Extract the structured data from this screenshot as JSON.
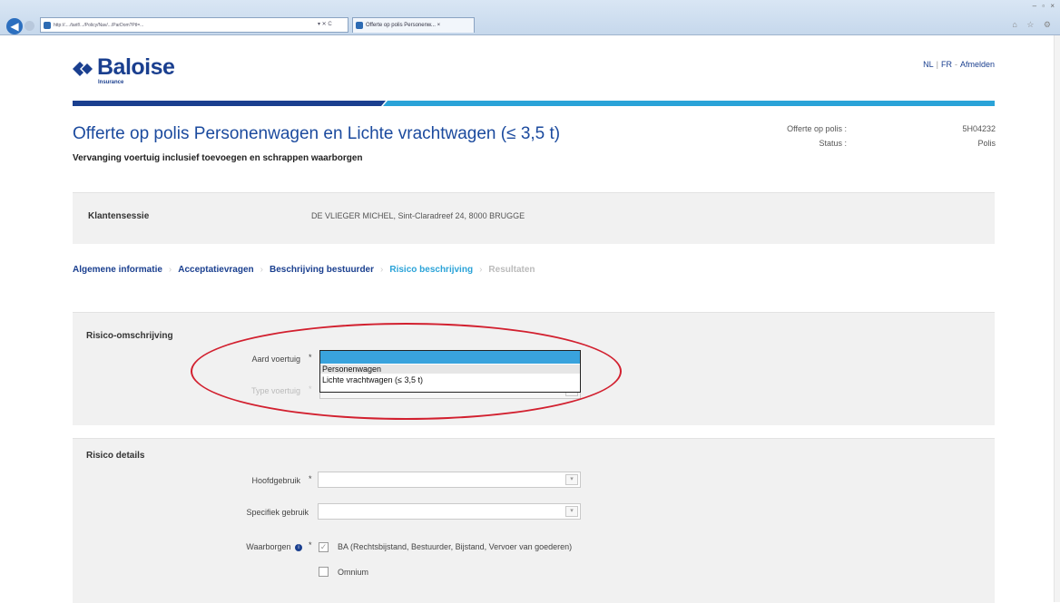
{
  "browser": {
    "address": "http://..../tarif/.../Policy/Nav/.../ParDom?Ptl=...",
    "address_controls": "▾ ✕ C",
    "tab_title": "Offerte op polis Personenw... ×",
    "window_controls": "– ▫ ×",
    "right_icons": "⌂ ☆ ⚙"
  },
  "header": {
    "logo_text": "Baloise",
    "logo_sub": "Insurance",
    "lang_nl": "NL",
    "lang_sep": "|",
    "lang_fr": "FR",
    "lang_sep2": "-",
    "logout": "Afmelden",
    "brand_dark": "#1a3f8f",
    "brand_light": "#2aa3d8"
  },
  "page": {
    "title": "Offerte op polis Personenwagen en Lichte vrachtwagen (≤ 3,5 t)",
    "subtitle": "Vervanging voertuig inclusief toevoegen en schrappen waarborgen",
    "meta": [
      {
        "label": "Offerte op polis :",
        "value": "5H04232"
      },
      {
        "label": "Status :",
        "value": "Polis"
      }
    ]
  },
  "session": {
    "label": "Klantensessie",
    "value": "DE VLIEGER MICHEL, Sint-Claradreef 24, 8000 BRUGGE"
  },
  "steps": [
    {
      "label": "Algemene informatie",
      "state": "done"
    },
    {
      "label": "Acceptatievragen",
      "state": "done"
    },
    {
      "label": "Beschrijving bestuurder",
      "state": "done"
    },
    {
      "label": "Risico beschrijving",
      "state": "current"
    },
    {
      "label": "Resultaten",
      "state": "future"
    }
  ],
  "risico_omschrijving": {
    "title": "Risico-omschrijving",
    "aard_label": "Aard voertuig",
    "type_label": "Type voertuig",
    "required_mark": "*",
    "options": [
      "Personenwagen",
      "Lichte vrachtwagen (≤ 3,5 t)"
    ],
    "highlighted_option": "Personenwagen"
  },
  "risico_details": {
    "title": "Risico details",
    "hoofdgebruik_label": "Hoofdgebruik",
    "specifiek_label": "Specifiek gebruik",
    "waarborgen_label": "Waarborgen",
    "info_icon": "i",
    "required_mark": "*",
    "guarantees": [
      {
        "label": "BA (Rechtsbijstand, Bestuurder, Bijstand, Vervoer van goederen)",
        "checked": true
      },
      {
        "label": "Omnium",
        "checked": false
      }
    ],
    "check_mark": "✓",
    "dropdown_glyph": "▾"
  },
  "annotation": {
    "color": "#d2202f"
  }
}
